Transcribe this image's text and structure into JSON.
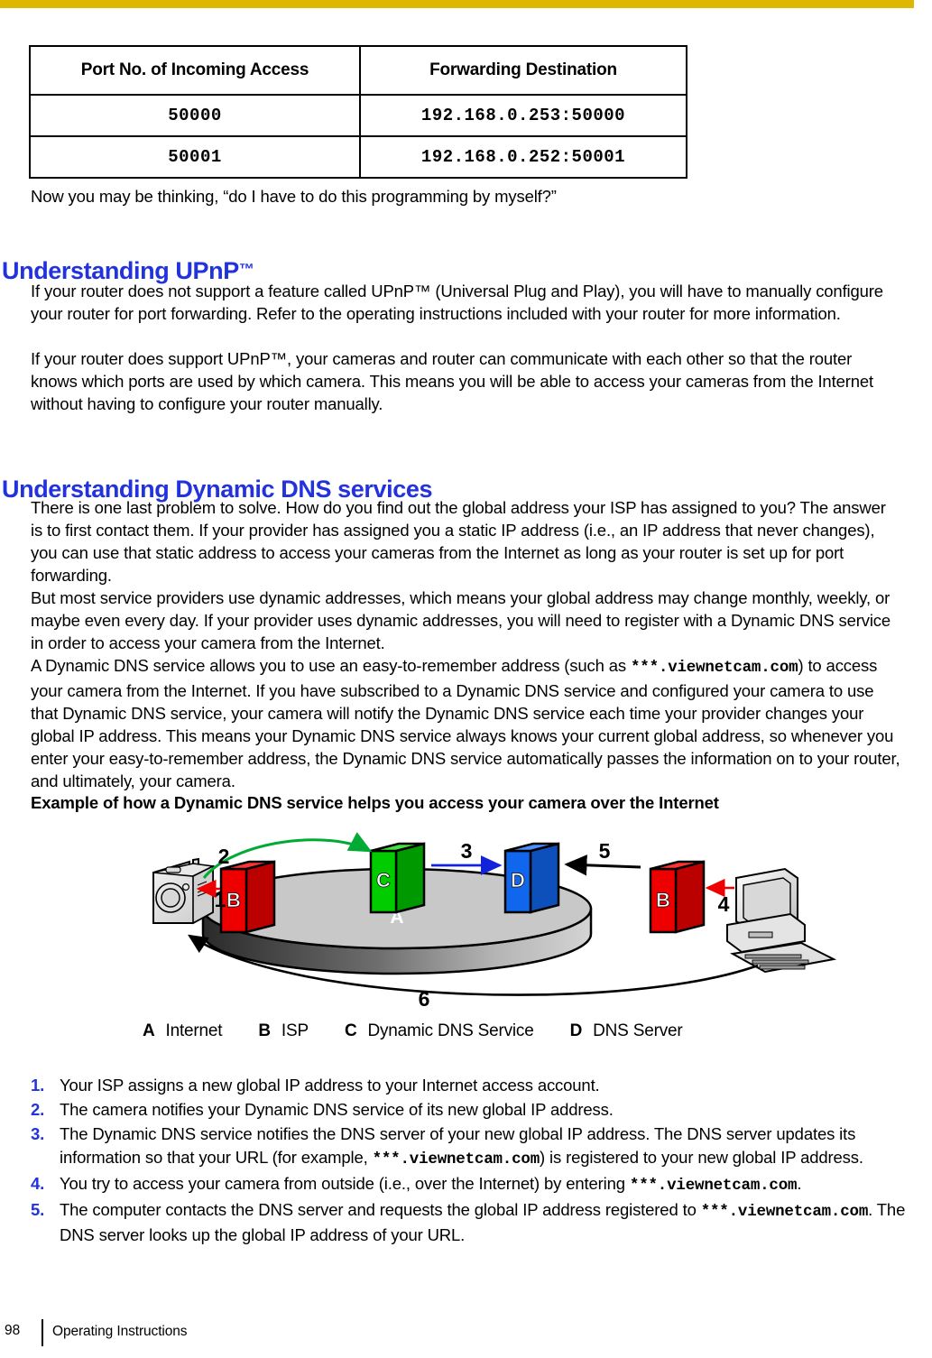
{
  "page": {
    "number": "98",
    "footer_text": "Operating Instructions",
    "accent_gold": "#deb800",
    "heading_blue": "#2232dd"
  },
  "port_table": {
    "headers": [
      "Port No. of Incoming Access",
      "Forwarding Destination"
    ],
    "rows": [
      [
        "50000",
        "192.168.0.253:50000"
      ],
      [
        "50001",
        "192.168.0.252:50001"
      ]
    ]
  },
  "intro_line": "Now you may be thinking, “do I have to do this programming by myself?”",
  "section_upnp": {
    "heading": "Understanding UPnP",
    "heading_tm": "™",
    "para1": "If your router does not support a feature called UPnP™ (Universal Plug and Play), you will have to manually configure your router for port forwarding. Refer to the operating instructions included with your router for more information.",
    "para2": "If your router does support UPnP™, your cameras and router can communicate with each other so that the router knows which ports are used by which camera. This means you will be able to access your cameras from the Internet without having to configure your router manually."
  },
  "section_ddns": {
    "heading": "Understanding Dynamic DNS services",
    "para1": "There is one last problem to solve. How do you find out the global address your ISP has assigned to you? The answer is to first contact them. If your provider has assigned you a static IP address (i.e., an IP address that never changes), you can use that static address to access your cameras from the Internet as long as your router is set up for port forwarding.",
    "para2": "But most service providers use dynamic addresses, which means your global address may change monthly, weekly, or maybe even every day. If your provider uses dynamic addresses, you will need to register with a Dynamic DNS service in order to access your camera from the Internet.",
    "para3_a": "A Dynamic DNS service allows you to use an easy-to-remember address (such as ",
    "para3_mono": "***.viewnetcam.com",
    "para3_b": ") to access your camera from the Internet. If you have subscribed to a Dynamic DNS service and configured your camera to use that Dynamic DNS service, your camera will notify the Dynamic DNS service each time your provider changes your global IP address. This means your Dynamic DNS service always knows your current global address, so whenever you enter your easy-to-remember address, the Dynamic DNS service automatically passes the information on to your router, and ultimately, your camera.",
    "example_caption": "Example of how a Dynamic DNS service helps you access your camera over the Internet"
  },
  "diagram": {
    "disc_label": "A",
    "step_numbers": [
      "1",
      "2",
      "3",
      "4",
      "5",
      "6"
    ],
    "boxes": [
      {
        "letter": "B",
        "color": "#ee0000",
        "role": "isp-left"
      },
      {
        "letter": "C",
        "color": "#00cc00",
        "role": "dynamic-dns-service"
      },
      {
        "letter": "D",
        "color": "#1166ee",
        "role": "dns-server"
      },
      {
        "letter": "B",
        "color": "#ee0000",
        "role": "isp-right"
      }
    ],
    "arrow_colors": {
      "one": "#ee0000",
      "two": "#00aa33",
      "three": "#1122dd",
      "four": "#ee0000",
      "five": "#000000",
      "six": "#000000"
    },
    "devices": [
      "network-camera",
      "desktop-computer"
    ]
  },
  "legend": [
    {
      "key": "A",
      "label": "Internet"
    },
    {
      "key": "B",
      "label": "ISP"
    },
    {
      "key": "C",
      "label": "Dynamic DNS Service"
    },
    {
      "key": "D",
      "label": "DNS Server"
    }
  ],
  "steps": [
    {
      "num": "1.",
      "parts": [
        {
          "t": "text",
          "v": "Your ISP assigns a new global IP address to your Internet access account."
        }
      ]
    },
    {
      "num": "2.",
      "parts": [
        {
          "t": "text",
          "v": "The camera notifies your Dynamic DNS service of its new global IP address."
        }
      ]
    },
    {
      "num": "3.",
      "parts": [
        {
          "t": "text",
          "v": "The Dynamic DNS service notifies the DNS server of your new global IP address. The DNS server updates its information so that your URL (for example, "
        },
        {
          "t": "mono",
          "v": "***.viewnetcam.com"
        },
        {
          "t": "text",
          "v": ") is registered to your new global IP address."
        }
      ]
    },
    {
      "num": "4.",
      "parts": [
        {
          "t": "text",
          "v": "You try to access your camera from outside (i.e., over the Internet) by entering "
        },
        {
          "t": "mono",
          "v": "***.viewnetcam.com"
        },
        {
          "t": "text",
          "v": "."
        }
      ]
    },
    {
      "num": "5.",
      "parts": [
        {
          "t": "text",
          "v": "The computer contacts the DNS server and requests the global IP address registered to "
        },
        {
          "t": "mono",
          "v": "***.viewnetcam.com"
        },
        {
          "t": "text",
          "v": ". The DNS server looks up the global IP address of your URL."
        }
      ]
    }
  ]
}
